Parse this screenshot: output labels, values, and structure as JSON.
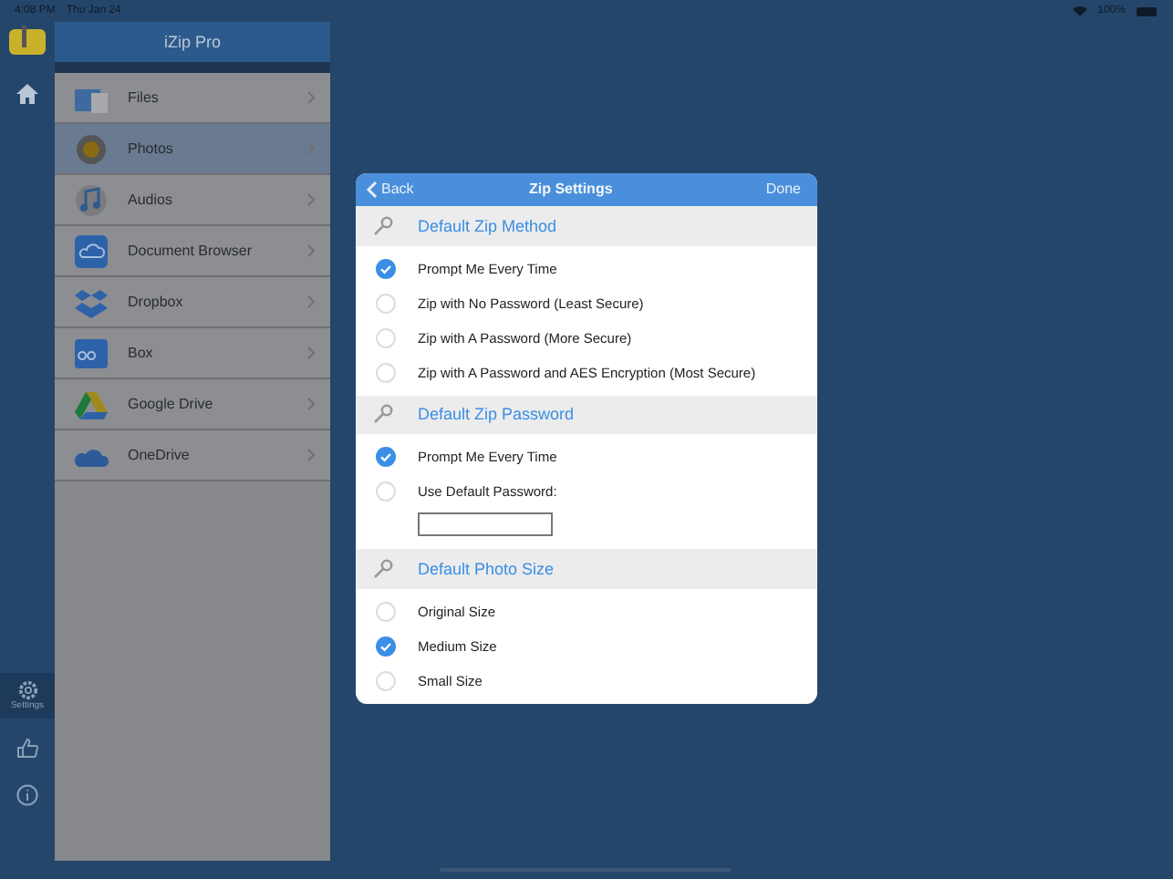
{
  "status_bar": {
    "time": "4:08 PM",
    "date": "Thu Jan 24",
    "battery": "100%"
  },
  "rail": {
    "items": [
      {
        "kind": "home",
        "selected": false
      },
      {
        "kind": "settings",
        "label": "Settings",
        "selected": true
      },
      {
        "kind": "like",
        "selected": false
      },
      {
        "kind": "info",
        "selected": false
      }
    ]
  },
  "sidebar": {
    "title": "iZip Pro",
    "items": [
      {
        "label": "Files",
        "kind": "files",
        "selected": false
      },
      {
        "label": "Photos",
        "kind": "photos",
        "selected": true
      },
      {
        "label": "Audios",
        "kind": "audios",
        "selected": false
      },
      {
        "label": "Document Browser",
        "kind": "cloud",
        "selected": false
      },
      {
        "label": "Dropbox",
        "kind": "dropbox",
        "selected": false
      },
      {
        "label": "Box",
        "kind": "box",
        "selected": false
      },
      {
        "label": "Google Drive",
        "kind": "drive",
        "selected": false
      },
      {
        "label": "OneDrive",
        "kind": "onedrive",
        "selected": false
      }
    ]
  },
  "dialog": {
    "back": "Back",
    "title": "Zip Settings",
    "done": "Done",
    "sections": [
      {
        "title": "Default Zip Method",
        "options": [
          {
            "label": "Prompt Me Every Time",
            "selected": true
          },
          {
            "label": "Zip with No Password (Least Secure)",
            "selected": false
          },
          {
            "label": "Zip with A Password (More Secure)",
            "selected": false
          },
          {
            "label": "Zip with A Password and AES Encryption (Most Secure)",
            "selected": false
          }
        ]
      },
      {
        "title": "Default Zip Password",
        "options": [
          {
            "label": "Prompt Me Every Time",
            "selected": true
          },
          {
            "label": "Use Default Password:",
            "selected": false,
            "field": true
          }
        ]
      },
      {
        "title": "Default Photo Size",
        "options": [
          {
            "label": "Original Size",
            "selected": false
          },
          {
            "label": "Medium Size",
            "selected": true
          },
          {
            "label": "Small Size",
            "selected": false
          }
        ]
      }
    ]
  }
}
